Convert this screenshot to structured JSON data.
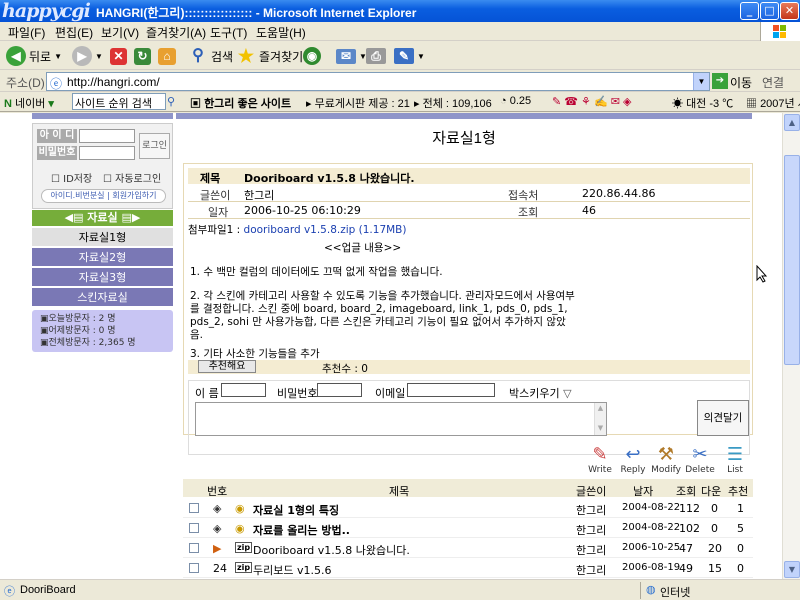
{
  "window": {
    "logo": "happycgi",
    "title": "HANGRI(한그리)::::::::::::::::: - Microsoft Internet Explorer",
    "minimize": "_",
    "maximize": "□",
    "close": "✕"
  },
  "menu": [
    "파일(F)",
    "편집(E)",
    "보기(V)",
    "즐겨찾기(A)",
    "도구(T)",
    "도움말(H)"
  ],
  "toolbar": {
    "back": "뒤로",
    "search": "검색",
    "favorites": "즐겨찾기"
  },
  "address": {
    "label": "주소(D)",
    "url": "http://hangri.com/",
    "go": "이동",
    "links": "연결"
  },
  "linkbar": {
    "naver": "네이버",
    "rank": "사이트 순위 검색",
    "site": "한그리 좋은 사이트",
    "free_board": "무료게시판 제공 : 21",
    "total": "전체 : 109,106",
    "rate": "0.25",
    "weather": "대전 -3 ℃",
    "date": "2007년 사"
  },
  "sidebar": {
    "id_label": "아 이 디",
    "pw_label": "비밀번호",
    "login_button": "로그인",
    "save_id": "ID저장",
    "auto_login": "자동로그인",
    "find_join": "아이디.비번분실 | 회원가입하기",
    "menu_head": "◀▤ 자료실 ▤▶",
    "items": [
      "자료실1형",
      "자료실2형",
      "자료실3형",
      "스킨자료실"
    ],
    "visitors": [
      "▣오늘방문자 : 2 명",
      "▣어제방문자 : 0 명",
      "▣전체방문자 : 2,365 명"
    ]
  },
  "page": {
    "title": "자료실1형"
  },
  "post": {
    "subject_label": "제목",
    "subject": "Dooriboard v1.5.8 나왔습니다.",
    "writer_label": "글쓴이",
    "writer": "한그리",
    "ip_label": "접속처",
    "ip": "220.86.44.86",
    "date_label": "일자",
    "date": "2006-10-25 06:10:29",
    "views_label": "조회",
    "views": "46",
    "attach_label": "첨부파일1 :",
    "attach": "dooriboard v1.5.8.zip (1.17MB)",
    "body": [
      "<<업글 내용>>",
      "1. 수 백만 컬럼의 데이터에도 끄떡 없게  작업을 했습니다.",
      "2. 각 스킨에 카테고리 사용할 수 있도록 기능을 추가했습니다. 관리자모드에서 사용여부",
      "를 결정합니다. 스킨 중에 board, board_2, imageboard, link_1, pds_0, pds_1,",
      "pds_2, sohi 만 사용가능합, 다른 스킨은 카테고리 기능이 필요 없어서 추가하지 않았",
      "음.",
      "3. 기타 사소한 기능들을 추가"
    ],
    "recommend_button": "추천해요",
    "recommend_count": "추천수 : 0"
  },
  "comment": {
    "name_label": "이 름",
    "pw_label": "비밀번호",
    "email_label": "이메일",
    "box_label": "박스키우기",
    "submit": "의견달기"
  },
  "actions": [
    "Write",
    "Reply",
    "Modify",
    "Delete",
    "List"
  ],
  "list": {
    "headers": [
      "번호",
      "제목",
      "글쓴이",
      "날자",
      "조회",
      "다운",
      "추천"
    ],
    "rows": [
      {
        "num": "",
        "title": "자료실 1형의 특징",
        "writer": "한그리",
        "date": "2004-08-22",
        "views": "112",
        "down": "0",
        "rec": "1",
        "bold": true
      },
      {
        "num": "",
        "title": "자료를 올리는 방법..",
        "writer": "한그리",
        "date": "2004-08-22",
        "views": "102",
        "down": "0",
        "rec": "5",
        "bold": true
      },
      {
        "num": "▶",
        "title": "Dooriboard v1.5.8 나왔습니다.",
        "writer": "한그리",
        "date": "2006-10-25",
        "views": "47",
        "down": "20",
        "rec": "0",
        "bold": false
      },
      {
        "num": "24",
        "title": "두리보드 v1.5.6",
        "writer": "한그리",
        "date": "2006-08-19",
        "views": "49",
        "down": "15",
        "rec": "0",
        "bold": false
      }
    ]
  },
  "status": {
    "text": "DooriBoard",
    "zone": "인터넷"
  }
}
